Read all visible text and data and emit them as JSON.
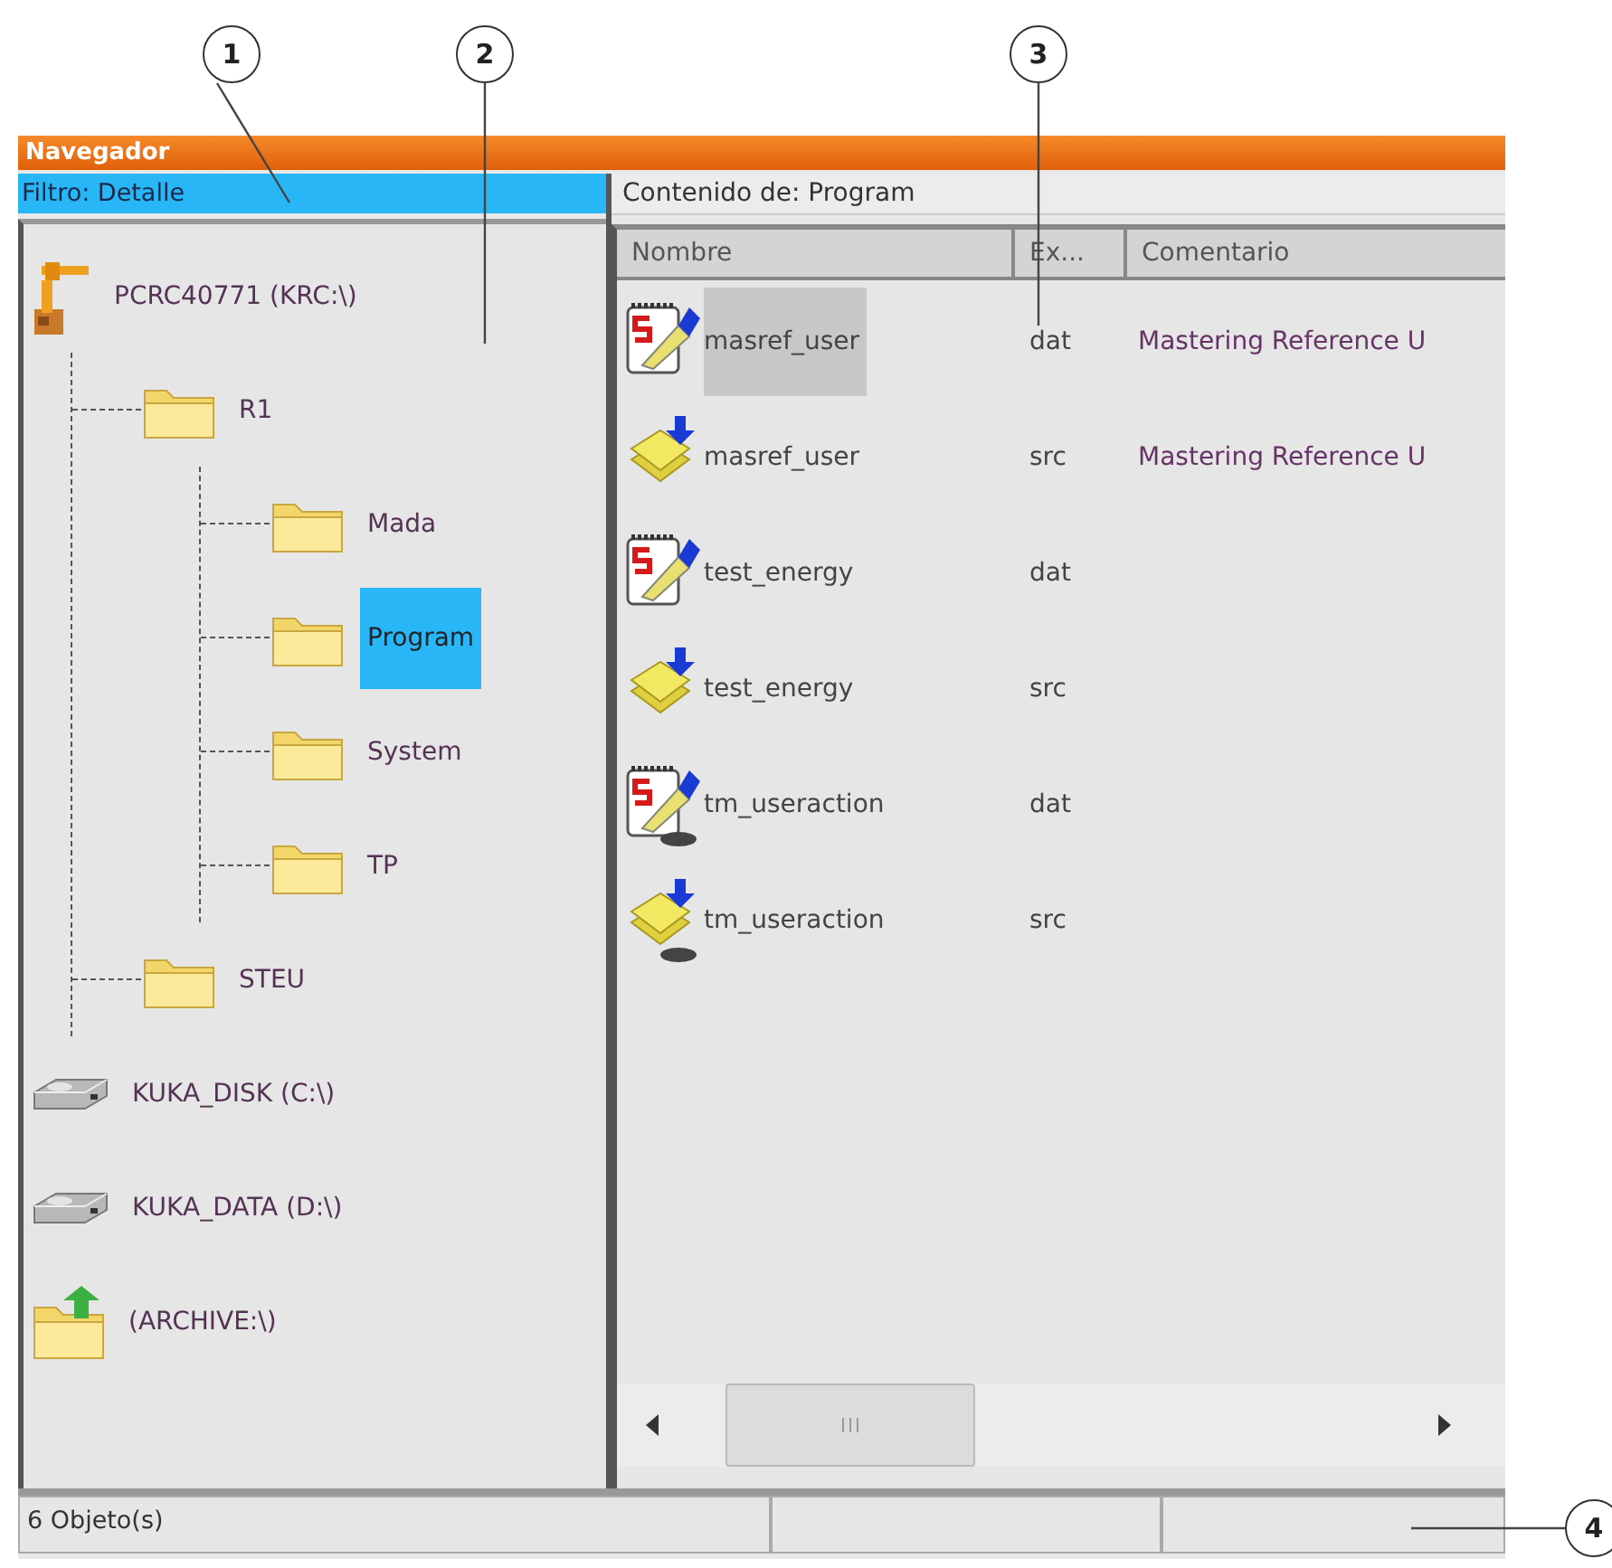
{
  "window": {
    "title": "Navegador"
  },
  "filter": "Filtro: Detalle",
  "tree": [
    {
      "label": "PCRC40771 (KRC:\\)",
      "kind": "robot",
      "selected": false,
      "children": [
        {
          "label": "R1",
          "kind": "folder",
          "selected": false,
          "children": [
            {
              "label": "Mada",
              "kind": "folder",
              "selected": false
            },
            {
              "label": "Program",
              "kind": "folder",
              "selected": true
            },
            {
              "label": "System",
              "kind": "folder",
              "selected": false
            },
            {
              "label": "TP",
              "kind": "folder",
              "selected": false
            }
          ]
        },
        {
          "label": "STEU",
          "kind": "folder",
          "selected": false
        }
      ]
    },
    {
      "label": "KUKA_DISK (C:\\)",
      "kind": "drive",
      "selected": false
    },
    {
      "label": "KUKA_DATA (D:\\)",
      "kind": "drive",
      "selected": false
    },
    {
      "label": "(ARCHIVE:\\)",
      "kind": "archive",
      "selected": false
    }
  ],
  "content": {
    "title": "Contenido de: Program",
    "columns": [
      "Nombre",
      "Ex...",
      "Comentario"
    ],
    "rows": [
      {
        "name": "masref_user",
        "ext": "dat",
        "comment": "Mastering Reference U",
        "kind": "dat",
        "linked": false,
        "selected": true
      },
      {
        "name": "masref_user",
        "ext": "src",
        "comment": "Mastering Reference U",
        "kind": "src",
        "linked": false,
        "selected": false
      },
      {
        "name": "test_energy",
        "ext": "dat",
        "kind": "dat",
        "linked": false,
        "selected": false
      },
      {
        "name": "test_energy",
        "ext": "src",
        "kind": "src",
        "linked": false,
        "selected": false
      },
      {
        "name": "tm_useraction",
        "ext": "dat",
        "kind": "dat",
        "linked": true,
        "selected": false
      },
      {
        "name": "tm_useraction",
        "ext": "src",
        "kind": "src",
        "linked": true,
        "selected": false
      }
    ]
  },
  "status_bar": {
    "text": "6 Objeto(s)"
  },
  "callouts": [
    "1",
    "2",
    "3",
    "4"
  ]
}
